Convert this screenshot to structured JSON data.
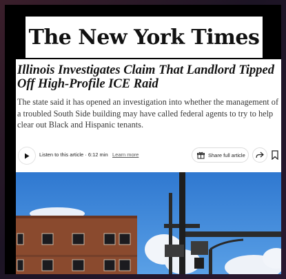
{
  "masthead": {
    "logo_text": "The New York Times"
  },
  "article": {
    "headline": "Illinois Investigates Claim That Landlord Tipped Off High-Profile ICE Raid",
    "dek": "The state said it has opened an investigation into whether the management of a troubled South Side building may have called federal agents to try to help clear out Black and Hispanic tenants."
  },
  "toolbar": {
    "listen_label": "Listen to this article · 6:12 min",
    "learn_more": "Learn more",
    "share_label": "Share full article",
    "icons": [
      "play-icon",
      "gift-icon",
      "forward-arrow-icon",
      "bookmark-icon"
    ]
  },
  "colors": {
    "sky": "#3f86d8",
    "brick": "#8a4a2e",
    "ink": "#121212"
  }
}
